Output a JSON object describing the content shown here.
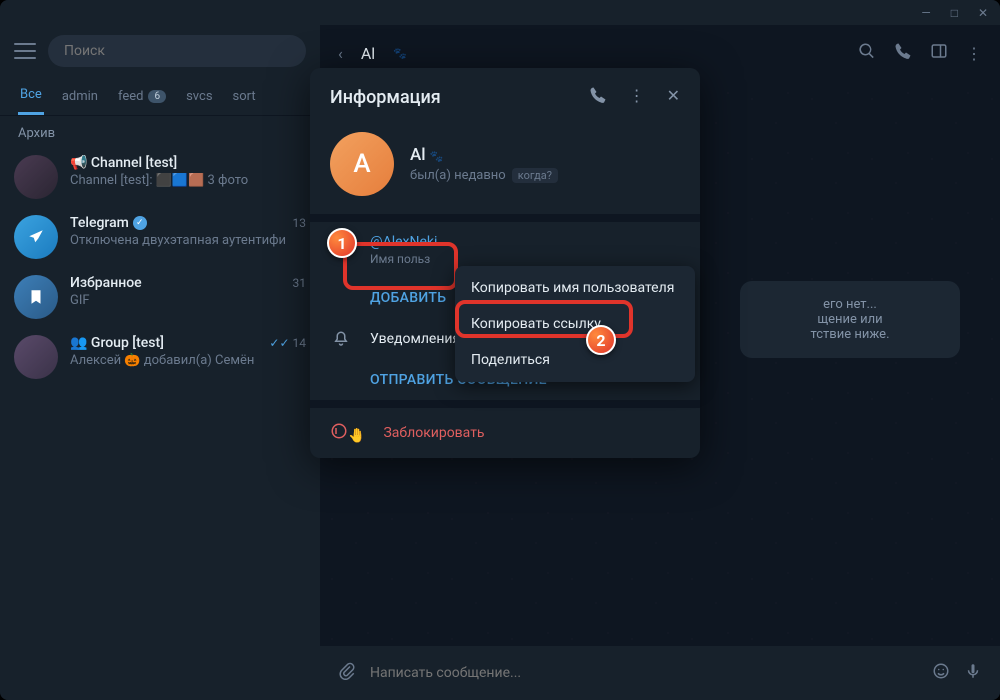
{
  "titlebar": {
    "min": "—",
    "max": "□",
    "close": "✕"
  },
  "sidebar": {
    "search_placeholder": "Поиск",
    "tabs": [
      {
        "label": "Все"
      },
      {
        "label": "admin"
      },
      {
        "label": "feed",
        "badge": "6"
      },
      {
        "label": "svcs"
      },
      {
        "label": "sort"
      }
    ],
    "archive_label": "Архив",
    "chats": [
      {
        "name": "📢 Channel [test]",
        "sub": "Channel [test]: ⬛🟦🟫 3 фото",
        "count": ""
      },
      {
        "name": "Telegram",
        "sub": "Отключена двухэтапная аутентифи",
        "count": "13",
        "verified": true
      },
      {
        "name": "Избранное",
        "sub": "GIF",
        "count": "31"
      },
      {
        "name": "👥 Group [test]",
        "sub": "Алексей 🎃 добавил(а) Семён",
        "count": "14",
        "checks": true
      }
    ]
  },
  "header": {
    "name": "Al"
  },
  "empty": {
    "line1": "его нет...",
    "line2": "щение или",
    "line3": "тствие ниже."
  },
  "input": {
    "placeholder": "Написать сообщение..."
  },
  "modal": {
    "title": "Информация",
    "name": "Al",
    "avatar_letter": "A",
    "status": "был(а) недавно",
    "when": "когда?",
    "username": "@AlexNeki",
    "username_label": "Имя польз",
    "add": "ДОБАВИТЬ",
    "notifications": "Уведомления",
    "send": "ОТПРАВИТЬ СООБЩЕНИЕ",
    "block": "Заблокировать"
  },
  "context": {
    "items": [
      "Копировать имя пользователя",
      "Копировать ссылку",
      "Поделиться"
    ]
  },
  "steps": {
    "s1": "1",
    "s2": "2"
  }
}
